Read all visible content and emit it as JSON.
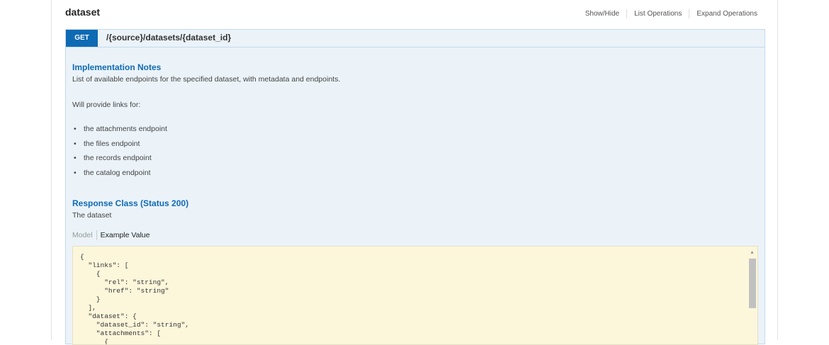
{
  "resource": {
    "title": "dataset",
    "actions": [
      "Show/Hide",
      "List Operations",
      "Expand Operations"
    ]
  },
  "operation": {
    "method": "GET",
    "path_prefix": "/{source}/datasets/{dataset_id}"
  },
  "implementation_notes": {
    "title": "Implementation Notes",
    "description": "List of available endpoints for the specified dataset, with metadata and endpoints.",
    "links_intro": "Will provide links for:",
    "items": [
      "the attachments endpoint",
      "the files endpoint",
      "the records endpoint",
      "the catalog endpoint"
    ]
  },
  "response": {
    "title": "Response Class (Status 200)",
    "description": "The dataset"
  },
  "tabs": {
    "model": "Model",
    "example": "Example Value"
  },
  "example_code": "{\n  \"links\": [\n    {\n      \"rel\": \"string\",\n      \"href\": \"string\"\n    }\n  ],\n  \"dataset\": {\n    \"dataset_id\": \"string\",\n    \"attachments\": [\n      {"
}
